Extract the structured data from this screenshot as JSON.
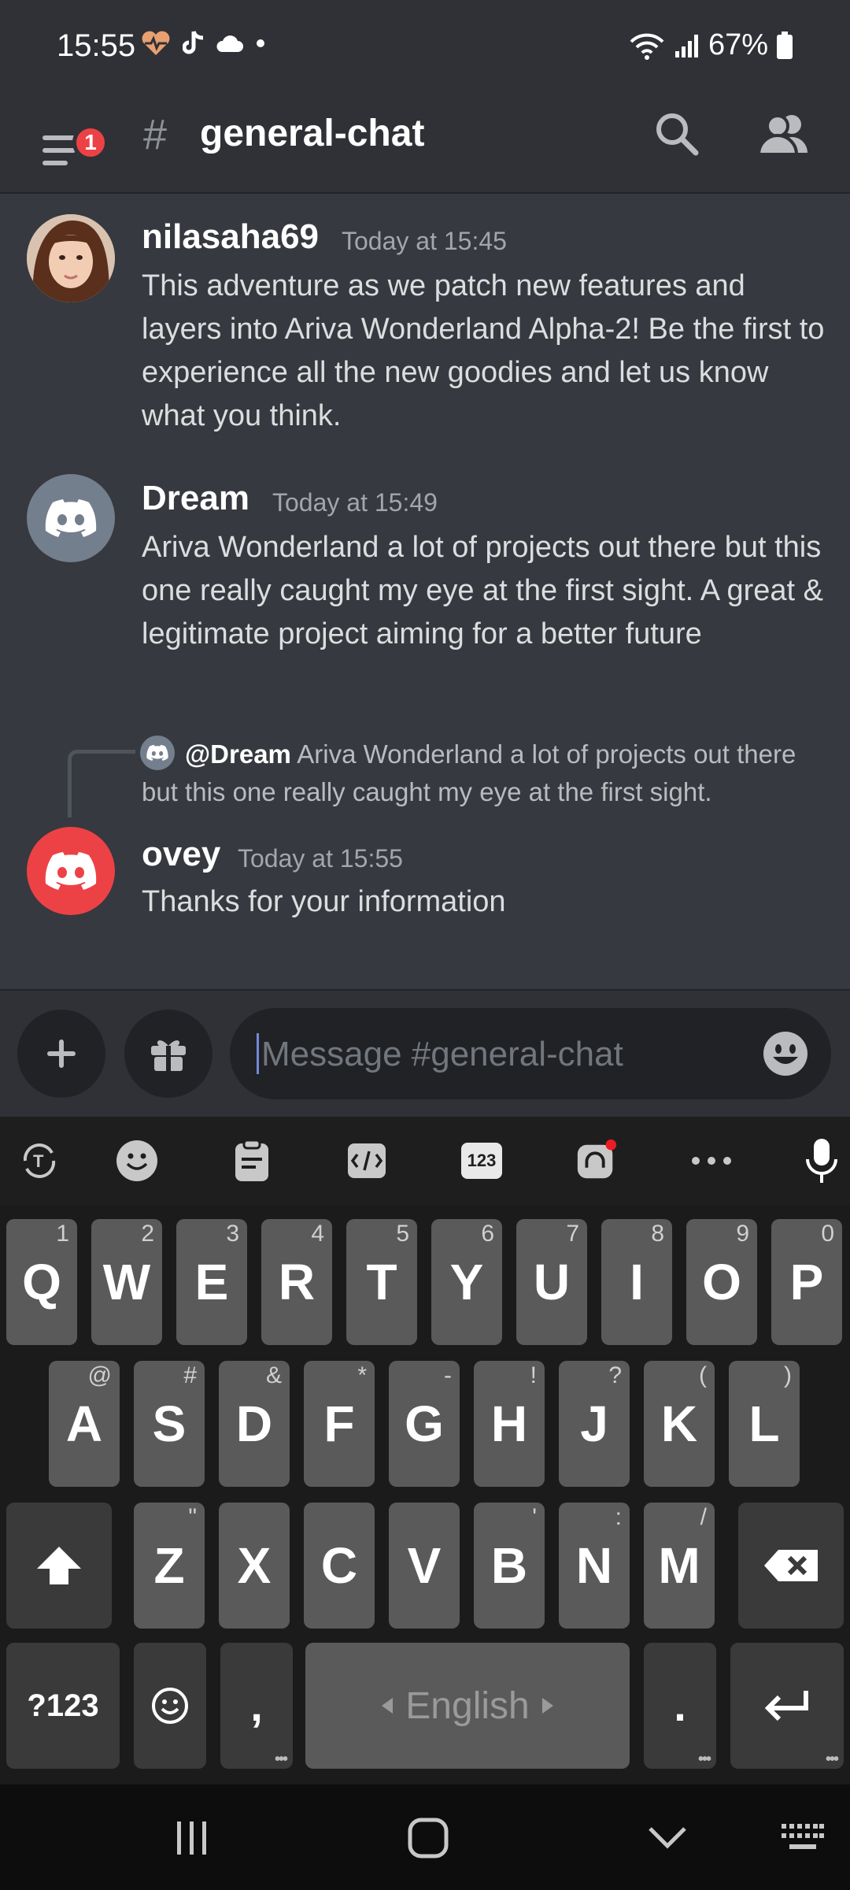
{
  "status_bar": {
    "time": "15:55",
    "battery": "67%"
  },
  "header": {
    "badge_count": "1",
    "hash": "#",
    "channel": "general-chat"
  },
  "messages": [
    {
      "username": "nilasaha69",
      "time": "Today at 15:45",
      "text": "This adventure as we patch new features and layers into Ariva Wonderland Alpha-2! Be the first to experience all the new goodies and let us know what you think."
    },
    {
      "username": "Dream",
      "time": "Today at 15:49",
      "text": "Ariva Wonderland a lot of projects out there but this one really caught my eye at the first sight. A great & legitimate project aiming for a better future"
    },
    {
      "reply_mention": "@Dream",
      "reply_text": "Ariva Wonderland a lot of projects out there but this one really caught my eye at the first sight.",
      "username": "ovey",
      "time": "Today at 15:55",
      "text": "Thanks for your information"
    }
  ],
  "input": {
    "placeholder": "Message #general-chat"
  },
  "keyboard": {
    "row1": [
      {
        "k": "Q",
        "h": "1"
      },
      {
        "k": "W",
        "h": "2"
      },
      {
        "k": "E",
        "h": "3"
      },
      {
        "k": "R",
        "h": "4"
      },
      {
        "k": "T",
        "h": "5"
      },
      {
        "k": "Y",
        "h": "6"
      },
      {
        "k": "U",
        "h": "7"
      },
      {
        "k": "I",
        "h": "8"
      },
      {
        "k": "O",
        "h": "9"
      },
      {
        "k": "P",
        "h": "0"
      }
    ],
    "row2": [
      {
        "k": "A",
        "h": "@"
      },
      {
        "k": "S",
        "h": "#"
      },
      {
        "k": "D",
        "h": "&"
      },
      {
        "k": "F",
        "h": "*"
      },
      {
        "k": "G",
        "h": "-"
      },
      {
        "k": "H",
        "h": "!"
      },
      {
        "k": "J",
        "h": "?"
      },
      {
        "k": "K",
        "h": "("
      },
      {
        "k": "L",
        "h": ")"
      }
    ],
    "row3": [
      {
        "k": "Z",
        "h": "\""
      },
      {
        "k": "X",
        "h": ""
      },
      {
        "k": "C",
        "h": ""
      },
      {
        "k": "V",
        "h": ""
      },
      {
        "k": "B",
        "h": "'"
      },
      {
        "k": "N",
        "h": ":"
      },
      {
        "k": "M",
        "h": "/"
      }
    ],
    "sym_key": "?123",
    "comma": ",",
    "space_label": "English",
    "period": "."
  }
}
